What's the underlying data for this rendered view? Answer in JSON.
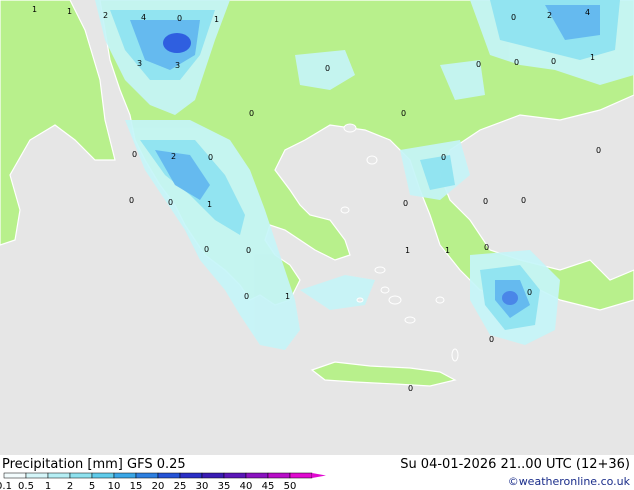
{
  "title": "Precipitation [mm]  GFS 0.25",
  "datetime": "Su 04-01-2026 21..00 UTC (12+36)",
  "credit": "©weatheronline.co.uk",
  "colors": {
    "sea": "#e6e6e6",
    "land": "#b8f08c",
    "coast": "#ffffff",
    "light_precip": "#c6f5f8",
    "mid_precip": "#8fe3f0",
    "heavy_precip": "#63b7ee",
    "core_precip": "#2f5fe0"
  },
  "legend": {
    "labels": [
      "0.1",
      "0.5",
      "1",
      "2",
      "5",
      "10",
      "15",
      "20",
      "25",
      "30",
      "35",
      "40",
      "45",
      "50"
    ],
    "colors": [
      "#f3fcfd",
      "#d5f6f9",
      "#b5eef4",
      "#8ee1ee",
      "#5fcbea",
      "#3aa6e6",
      "#2d7fe0",
      "#2553d6",
      "#2a2fc6",
      "#3a1cb4",
      "#5b16b8",
      "#8a12c0",
      "#b80ec8",
      "#e00ad0"
    ]
  },
  "point_values": [
    "1",
    "1",
    "2",
    "4",
    "0",
    "1",
    "0",
    "2",
    "4",
    "3",
    "3",
    "1",
    "0",
    "0",
    "0",
    "0",
    "0",
    "0",
    "2",
    "0",
    "0",
    "0",
    "1",
    "0",
    "0",
    "0",
    "0",
    "0",
    "0",
    "1",
    "1",
    "0",
    "0",
    "0",
    "0",
    "1",
    "0",
    "0",
    "0"
  ]
}
